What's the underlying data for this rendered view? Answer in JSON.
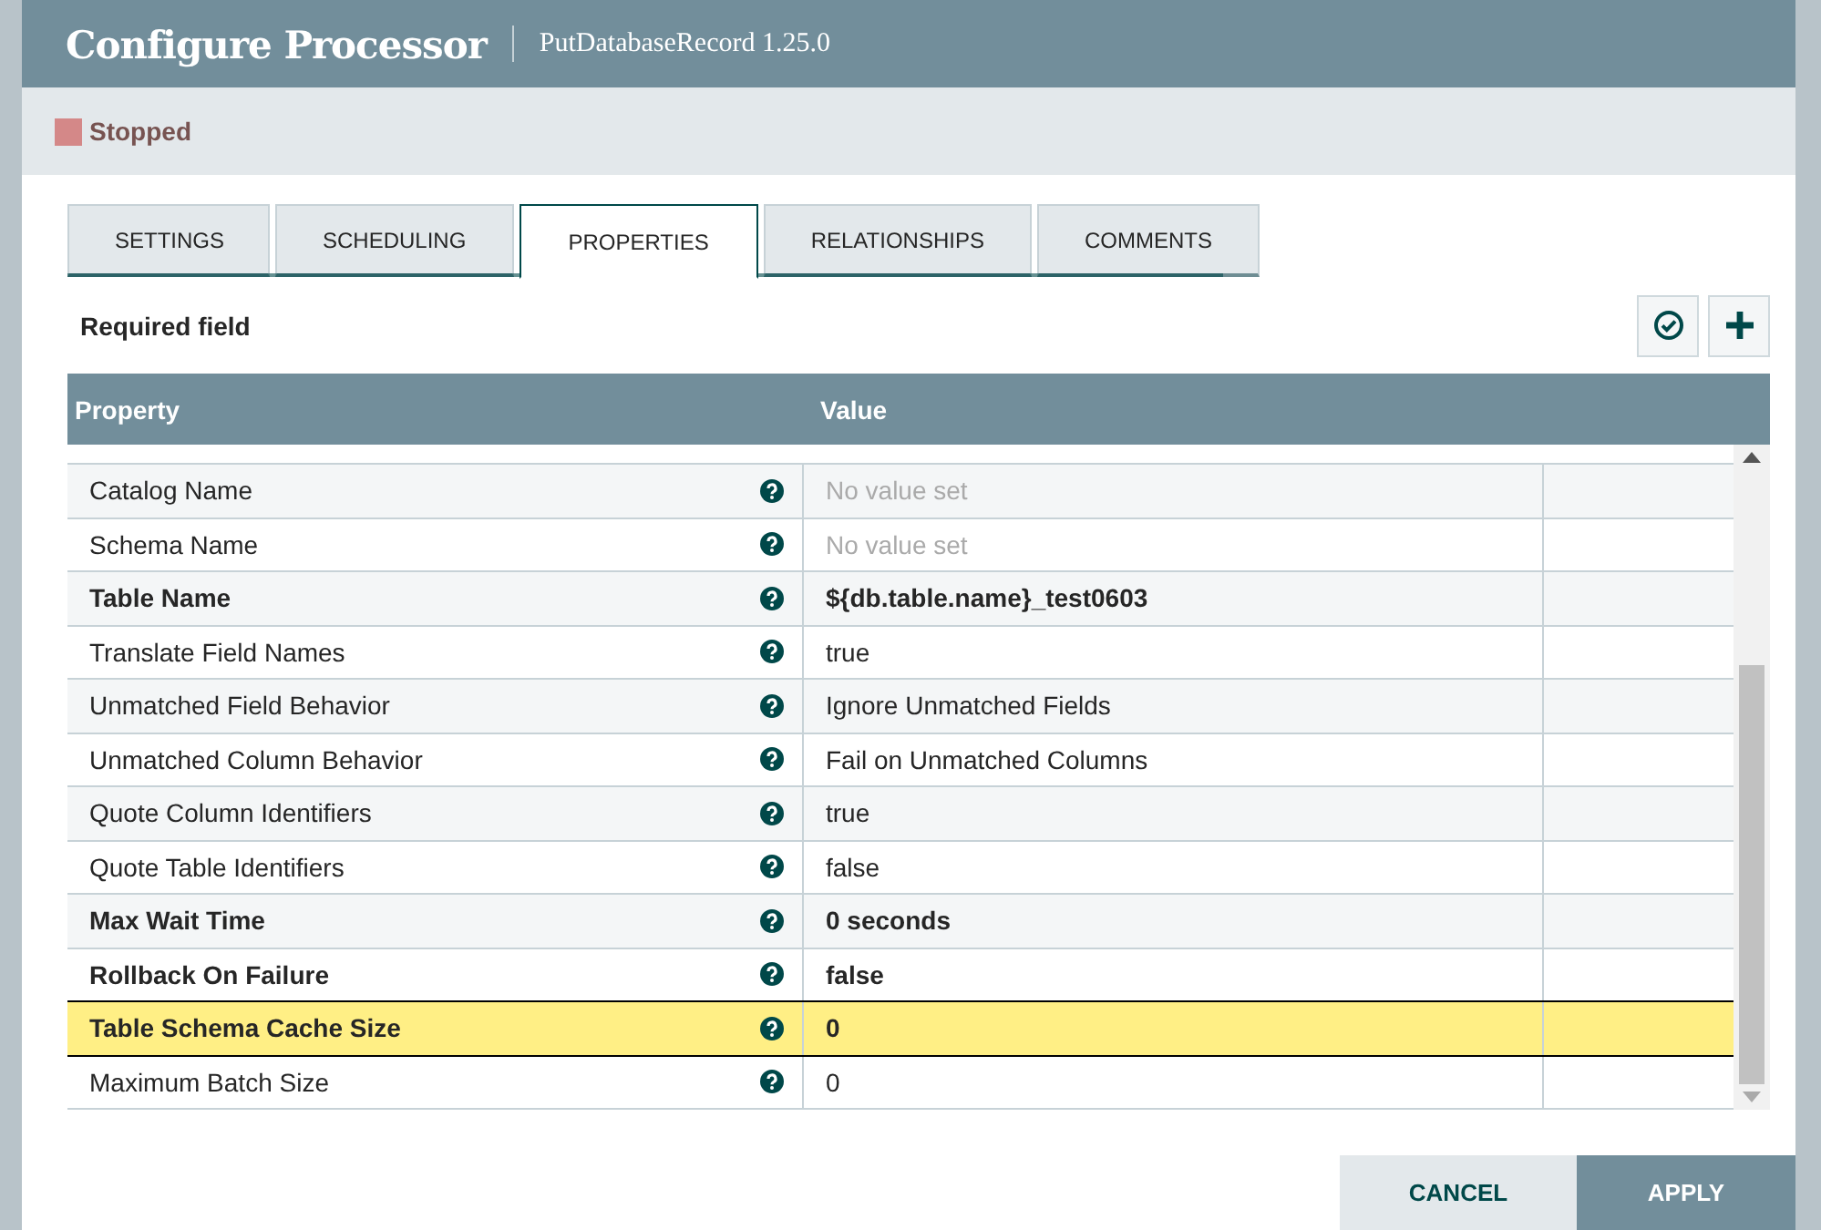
{
  "dialog": {
    "title": "Configure Processor",
    "subtitle": "PutDatabaseRecord 1.25.0"
  },
  "status": {
    "label": "Stopped",
    "color": "#d48888"
  },
  "tabs": [
    {
      "label": "SETTINGS",
      "selected": false
    },
    {
      "label": "SCHEDULING",
      "selected": false
    },
    {
      "label": "PROPERTIES",
      "selected": true
    },
    {
      "label": "RELATIONSHIPS",
      "selected": false
    },
    {
      "label": "COMMENTS",
      "selected": false
    }
  ],
  "required_note": "Required field",
  "table": {
    "columns": [
      "Property",
      "Value"
    ],
    "rows": [
      {
        "property": "Catalog Name",
        "value": "No value set",
        "required": false,
        "unset": true,
        "selected": false
      },
      {
        "property": "Schema Name",
        "value": "No value set",
        "required": false,
        "unset": true,
        "selected": false
      },
      {
        "property": "Table Name",
        "value": "${db.table.name}_test0603",
        "required": true,
        "unset": false,
        "selected": false
      },
      {
        "property": "Translate Field Names",
        "value": "true",
        "required": false,
        "unset": false,
        "selected": false
      },
      {
        "property": "Unmatched Field Behavior",
        "value": "Ignore Unmatched Fields",
        "required": false,
        "unset": false,
        "selected": false
      },
      {
        "property": "Unmatched Column Behavior",
        "value": "Fail on Unmatched Columns",
        "required": false,
        "unset": false,
        "selected": false
      },
      {
        "property": "Quote Column Identifiers",
        "value": "true",
        "required": false,
        "unset": false,
        "selected": false
      },
      {
        "property": "Quote Table Identifiers",
        "value": "false",
        "required": false,
        "unset": false,
        "selected": false
      },
      {
        "property": "Max Wait Time",
        "value": "0 seconds",
        "required": true,
        "unset": false,
        "selected": false
      },
      {
        "property": "Rollback On Failure",
        "value": "false",
        "required": true,
        "unset": false,
        "selected": false
      },
      {
        "property": "Table Schema Cache Size",
        "value": "0",
        "required": true,
        "unset": false,
        "selected": true
      },
      {
        "property": "Maximum Batch Size",
        "value": "0",
        "required": false,
        "unset": false,
        "selected": false
      }
    ]
  },
  "buttons": [
    {
      "label": "CANCEL",
      "kind": "secondary"
    },
    {
      "label": "APPLY",
      "kind": "primary"
    }
  ]
}
